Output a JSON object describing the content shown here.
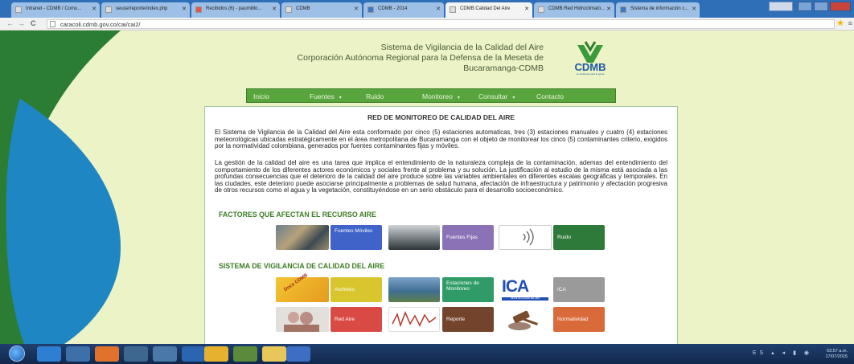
{
  "browser": {
    "tabs": [
      {
        "label": "Intranet - CDMB / Comu..."
      },
      {
        "label": "seuse/reporte/index.php"
      },
      {
        "label": "Recibidos (6) - paumilllo..."
      },
      {
        "label": "CDMB"
      },
      {
        "label": "CDMB - 2014"
      },
      {
        "label": "CDMB:Calidad Del Aire"
      },
      {
        "label": "CDMB:Red Hidroclimato..."
      },
      {
        "label": "Sistema de información c..."
      }
    ],
    "url": "caracoli.cdmb.gov.co/cai/cai2/",
    "back": "←",
    "forward": "→",
    "reload": "C",
    "star": "★",
    "menu": "≡"
  },
  "header": {
    "title_line1": "Sistema de Vigilancia de la Calidad del Aire",
    "title_line2": "Corporación Autónoma Regional para la Defensa de la Meseta de",
    "title_line3": "Bucaramanga-CDMB",
    "logo_text": "CDMB",
    "logo_tagline": "un ambiente para la gente"
  },
  "nav": {
    "items": [
      {
        "label": "Inicio"
      },
      {
        "label": "Fuentes"
      },
      {
        "label": "Ruido"
      },
      {
        "label": "Monitoreo"
      },
      {
        "label": "Consultar"
      },
      {
        "label": "Contacto"
      }
    ],
    "caret": "▾"
  },
  "content": {
    "heading": "RED DE MONITOREO DE CALIDAD DEL AIRE",
    "paragraph1": "El Sistema de Vigilancia de la Calidad del Aire esta conformado por cinco (5) estaciones automaticas, tres (3) estaciones manuales y cuatro (4) estaciones meteorológicas ubicadas estratégicamente en el área metropolitana de Bucaramanga con el objeto de monitorear los cinco (5) contaminantes criterio, exigidos por la normatividad colombiana, generados por fuentes contaminantes fijas y móviles.",
    "paragraph2": "La gestión de la calidad del aire es una tarea que implica el entendimiento de la naturaleza compleja de la contaminación, ademas del entendimiento del comportamiento de los diferentes actores económicos y sociales frente al problema y su solución. La justificación al estudio de la misma está asociada a las profundas consecuencias que el deterioro de la calidad del aire produce sobre las variables ambientales en diferentes escalas geográficas y temporales. En las ciudades, este deterioro puede asociarse principalmente a problemas de salud humana, afectación de infraestructura y patrimonio y afectación progresiva de otros recursos como el agua y la vegetación, constituyéndose en un serio obstáculo para el desarrollo socioeconómico.",
    "section1": "FACTORES QUE AFECTAN EL RECURSO AIRE",
    "section2": "SISTEMA DE VIGILANCIA DE CALIDAD DEL AIRE",
    "factors": [
      {
        "label": "Fuentes Móviles",
        "color": "#3f63c9"
      },
      {
        "label": "Fuentes Fijas",
        "color": "#8b72b6"
      },
      {
        "label": "Ruido",
        "color": "#2e7a3a"
      }
    ],
    "system": [
      {
        "label": "Archivos",
        "color": "#d9c62f",
        "photo_text": "Docs CDMB"
      },
      {
        "label": "Estaciones de Monitoreo",
        "color": "#2f9c67"
      },
      {
        "label": "ICA",
        "color": "#9a9a9a",
        "photo_text": "ICA",
        "photo_sub": "ÍNDICE DE CALIDAD DEL AIRE"
      },
      {
        "label": "Red Aire",
        "color": "#d94a45"
      },
      {
        "label": "Reporte",
        "color": "#74432c"
      },
      {
        "label": "Normatividad",
        "color": "#d96a3a"
      }
    ]
  },
  "taskbar": {
    "time": "03:57 a.m.",
    "date": "17/07/2015",
    "lang": "ES"
  }
}
